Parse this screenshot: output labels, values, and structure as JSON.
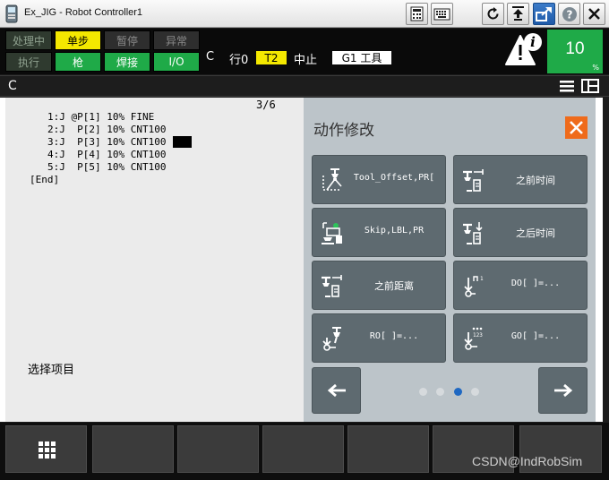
{
  "window": {
    "title": "Ex_JIG - Robot Controller1",
    "app_icon": "teach-pendant-icon",
    "toolbar_icons": [
      "keypad-icon",
      "keyboard-icon",
      "refresh-icon",
      "step-icon",
      "screen-switch-icon",
      "help-icon",
      "close-icon"
    ]
  },
  "status": {
    "indicators": [
      {
        "label": "处理中",
        "state": "off"
      },
      {
        "label": "单步",
        "state": "yellow"
      },
      {
        "label": "暂停",
        "state": "grey"
      },
      {
        "label": "异常",
        "state": "grey"
      },
      {
        "label": "执行",
        "state": "off"
      },
      {
        "label": "枪",
        "state": "green"
      },
      {
        "label": "焊接",
        "state": "green"
      },
      {
        "label": "I/O",
        "state": "green"
      }
    ],
    "program": "C",
    "line": "行0",
    "mode": "T2",
    "state": "中止",
    "group_tool": "G1 工具",
    "override_value": "10",
    "override_unit": "%",
    "alert_icon": "alert-info-icon",
    "colors": {
      "yellow": "#f4e800",
      "green": "#1faa48"
    }
  },
  "breadcrumb": {
    "label": "C",
    "icons": [
      "menu-icon",
      "split-view-icon"
    ]
  },
  "program": {
    "position": "3/6",
    "lines": [
      "1:J @P[1] 10% FINE",
      "2:J  P[2] 10% CNT100",
      "3:J  P[3] 10% CNT100",
      "4:J  P[4] 10% CNT100",
      "5:J  P[5] 10% CNT100",
      "[End]"
    ],
    "prompt": "选择项目"
  },
  "motion_panel": {
    "title": "动作修改",
    "close_icon": "close-x-icon",
    "buttons": [
      {
        "label": "Tool_Offset,PR[",
        "icon": "tool-offset-icon"
      },
      {
        "label": "之前时间",
        "icon": "time-before-icon"
      },
      {
        "label": "Skip,LBL,PR",
        "icon": "skip-icon"
      },
      {
        "label": "之后时间",
        "icon": "time-after-icon"
      },
      {
        "label": "之前距离",
        "icon": "distance-before-icon"
      },
      {
        "label": "DO[   ]=...",
        "icon": "digital-output-icon"
      },
      {
        "label": "RO[   ]=...",
        "icon": "robot-output-icon"
      },
      {
        "label": "GO[   ]=...",
        "icon": "group-output-icon"
      }
    ],
    "prev_icon": "arrow-left-icon",
    "next_icon": "arrow-right-icon",
    "page_count": 4,
    "active_page": 3,
    "accent": "#ef6b1b"
  },
  "function_keys": {
    "first_icon": "grid-menu-icon",
    "count": 7
  },
  "watermark": "CSDN@IndRobSim"
}
